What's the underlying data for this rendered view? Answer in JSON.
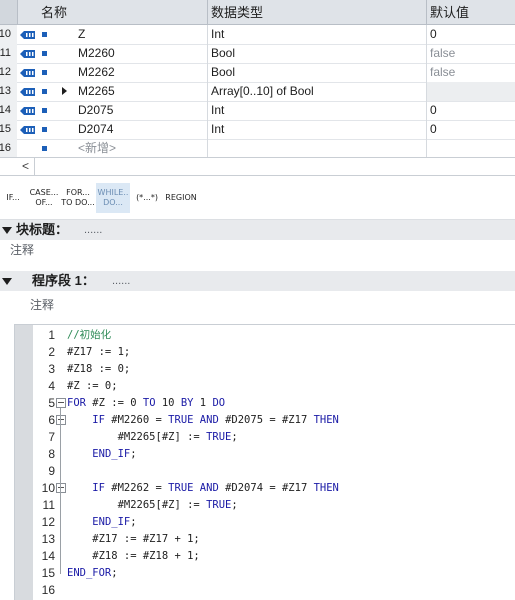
{
  "table": {
    "headers": {
      "name": "名称",
      "type": "数据类型",
      "default": "默认值"
    },
    "rows": [
      {
        "num": "10",
        "name": "Z",
        "type": "Int",
        "default": "0",
        "default_muted": false,
        "expandable": false
      },
      {
        "num": "11",
        "name": "M2260",
        "type": "Bool",
        "default": "false",
        "default_muted": true,
        "expandable": false
      },
      {
        "num": "12",
        "name": "M2262",
        "type": "Bool",
        "default": "false",
        "default_muted": true,
        "expandable": false
      },
      {
        "num": "13",
        "name": "M2265",
        "type": "Array[0..10] of Bool",
        "default": "",
        "default_muted": false,
        "expandable": true
      },
      {
        "num": "14",
        "name": "D2075",
        "type": "Int",
        "default": "0",
        "default_muted": false,
        "expandable": false
      },
      {
        "num": "15",
        "name": "D2074",
        "type": "Int",
        "default": "0",
        "default_muted": false,
        "expandable": false
      }
    ],
    "new_row": {
      "num": "16",
      "label": "<新增>"
    }
  },
  "scroll": {
    "left_arrow": "<"
  },
  "toolbar": [
    {
      "label": "IF...",
      "active": false
    },
    {
      "label": "CASE...\nOF...",
      "active": false
    },
    {
      "label": "FOR...\nTO DO...",
      "active": false
    },
    {
      "label": "WHILE..\nDO...",
      "active": true
    },
    {
      "label": "(*...*)",
      "active": false
    },
    {
      "label": "REGION",
      "active": false
    }
  ],
  "block_title": {
    "label": "块标题：",
    "dots": "......",
    "comment": "注释"
  },
  "network": {
    "label": "程序段 1：",
    "dots": "......",
    "comment": "注释"
  },
  "code": {
    "lines": [
      {
        "n": "1",
        "text": "//初始化"
      },
      {
        "n": "2",
        "text": "#Z17 := 1;"
      },
      {
        "n": "3",
        "text": "#Z18 := 0;"
      },
      {
        "n": "4",
        "text": "#Z := 0;"
      },
      {
        "n": "5",
        "text": "FOR #Z := 0 TO 10 BY 1 DO"
      },
      {
        "n": "6",
        "text": "    IF #M2260 = TRUE AND #D2075 = #Z17 THEN"
      },
      {
        "n": "7",
        "text": "        #M2265[#Z] := TRUE;"
      },
      {
        "n": "8",
        "text": "    END_IF;"
      },
      {
        "n": "9",
        "text": ""
      },
      {
        "n": "10",
        "text": "    IF #M2262 = TRUE AND #D2074 = #Z17 THEN"
      },
      {
        "n": "11",
        "text": "        #M2265[#Z] := TRUE;"
      },
      {
        "n": "12",
        "text": "    END_IF;"
      },
      {
        "n": "13",
        "text": "    #Z17 := #Z17 + 1;"
      },
      {
        "n": "14",
        "text": "    #Z18 := #Z18 + 1;"
      },
      {
        "n": "15",
        "text": "END_FOR;"
      },
      {
        "n": "16",
        "text": ""
      }
    ]
  },
  "colors": {
    "keyword": "#1a1aa6",
    "comment": "#2e8b57",
    "interface_icon": "#1c5fb8"
  }
}
